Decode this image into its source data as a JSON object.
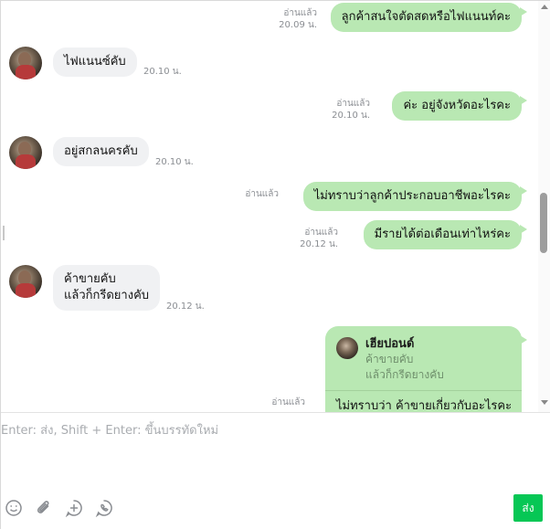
{
  "chat": {
    "messages": [
      {
        "dir": "out",
        "text": "ลูกค้าสนใจตัดสดหรือไฟแนนท์คะ",
        "read": "อ่านแล้ว",
        "time": "20.09 น."
      },
      {
        "dir": "in",
        "text": "ไฟแนนซ์คับ",
        "time": "20.10 น."
      },
      {
        "dir": "out",
        "text": "ค่ะ อยู่จังหวัดอะไรคะ",
        "read": "อ่านแล้ว",
        "time": "20.10 น."
      },
      {
        "dir": "in",
        "text": "อยู่สกลนครคับ",
        "time": "20.10 น."
      },
      {
        "dir": "out",
        "text": "ไม่ทราบว่าลูกค้าประกอบอาชีพอะไรคะ",
        "read": "อ่านแล้ว",
        "time": ""
      },
      {
        "dir": "out",
        "text": "มีรายได้ต่อเดือนเท่าไหร่คะ",
        "read": "อ่านแล้ว",
        "time": "20.12 น."
      },
      {
        "dir": "in",
        "line1": "ค้าขายคับ",
        "line2": "แล้วก็กรีดยางคับ",
        "time": "20.12 น."
      }
    ],
    "reply": {
      "quoted_name": "เฮียปอนด์",
      "quoted_line1": "ค้าขายคับ",
      "quoted_line2": "แล้วก็กรีดยางคับ",
      "text": "ไม่ทราบว่า ค้าขายเกี่ยวกับอะไรคะ",
      "read": "อ่านแล้ว"
    }
  },
  "composer": {
    "placeholder": "Enter: ส่ง, Shift + Enter: ขึ้นบรรทัดใหม่",
    "send_label": "ส่ง",
    "tools": [
      "smiley-icon",
      "paperclip-icon",
      "plus-circle-icon",
      "phone-bubble-icon"
    ]
  },
  "colors": {
    "outgoing_bubble": "#b9e8b3",
    "incoming_bubble": "#f0f1f3",
    "send_button": "#06c755"
  }
}
